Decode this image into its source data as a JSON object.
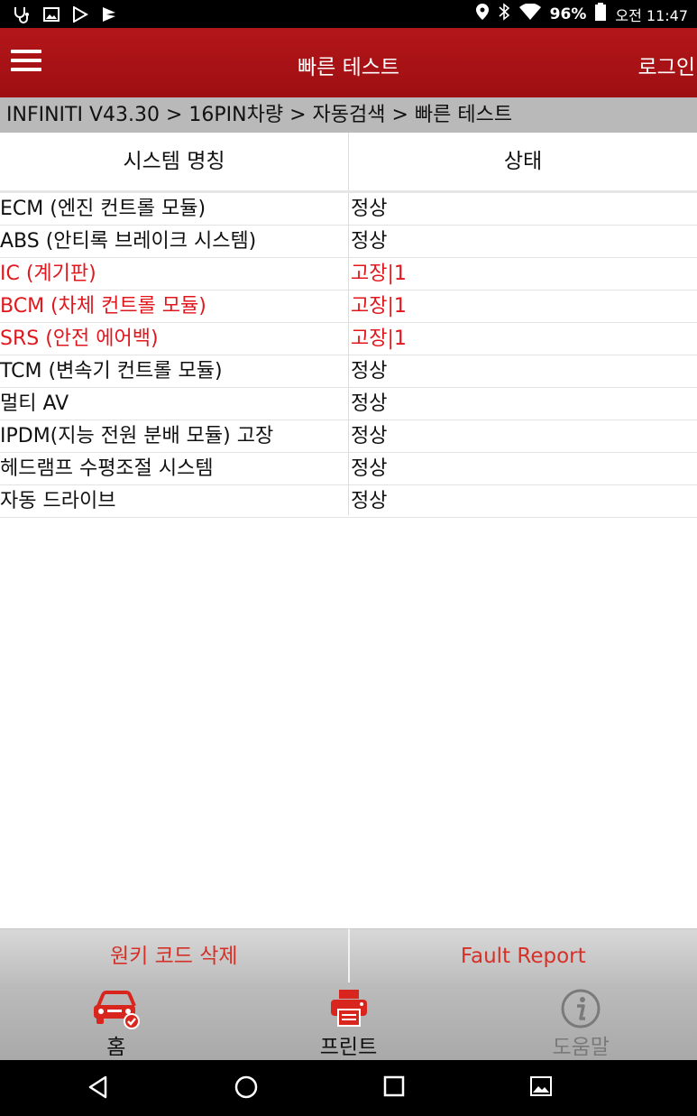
{
  "status_bar": {
    "battery": "96%",
    "time": "오전 11:47",
    "icons": [
      "stethoscope-icon",
      "image-icon",
      "play-store-icon",
      "flag-icon",
      "location-icon",
      "bluetooth-icon",
      "wifi-icon",
      "battery-icon"
    ]
  },
  "app_bar": {
    "title": "빠른 테스트",
    "login_label": "로그인",
    "menu_icon": "hamburger-menu-icon"
  },
  "breadcrumb": "INFINITI V43.30 > 16PIN차량 > 자동검색 > 빠른 테스트",
  "table": {
    "headers": [
      "시스템 명칭",
      "상태"
    ],
    "rows": [
      {
        "name": "ECM (엔진 컨트롤 모듈)",
        "status": "정상"
      },
      {
        "name": "ABS (안티록 브레이크 시스템)",
        "status": "정상"
      },
      {
        "name": "IC (계기판)",
        "status": "고장|1"
      },
      {
        "name": "BCM (차체 컨트롤 모듈)",
        "status": "고장|1"
      },
      {
        "name": "SRS (안전 에어백)",
        "status": "고장|1"
      },
      {
        "name": "TCM (변속기 컨트롤 모듈)",
        "status": "정상"
      },
      {
        "name": "멀티 AV",
        "status": "정상"
      },
      {
        "name": "IPDM(지능 전원 분배 모듈) 고장",
        "status": "정상"
      },
      {
        "name": "헤드램프 수평조절 시스템",
        "status": "정상"
      },
      {
        "name": "자동 드라이브",
        "status": "정상"
      }
    ]
  },
  "actions": {
    "clear_codes": "원키 코드 삭제",
    "fault_report": "Fault Report"
  },
  "bottom_nav": {
    "home": "홈",
    "print": "프린트",
    "help": "도움말"
  },
  "colors": {
    "accent_red": "#a81216",
    "fault_text": "#e0181e",
    "action_text": "#d63128"
  }
}
